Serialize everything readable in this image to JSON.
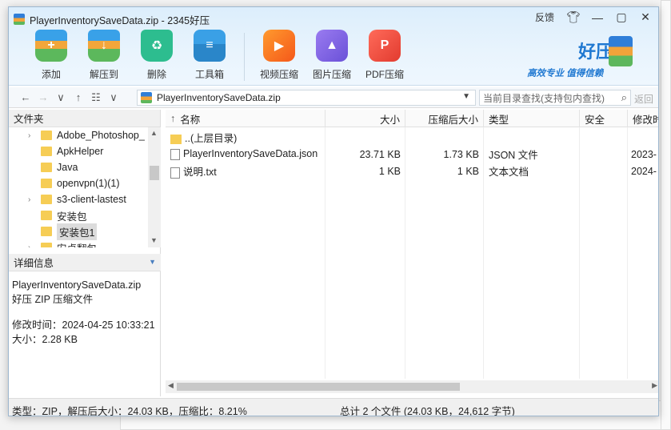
{
  "window": {
    "title": "PlayerInventorySaveData.zip - 2345好压",
    "feedback": "反馈",
    "skin_icon": "shirt-icon",
    "minimize_icon": "minimize-icon",
    "maximize_icon": "maximize-icon",
    "close_icon": "close-icon"
  },
  "toolbar": [
    {
      "label": "添加",
      "icon": "add-archive-icon"
    },
    {
      "label": "解压到",
      "icon": "extract-icon"
    },
    {
      "label": "删除",
      "icon": "recycle-icon"
    },
    {
      "label": "工具箱",
      "icon": "toolbox-icon"
    },
    {
      "label": "视频压缩",
      "icon": "video-compress-icon"
    },
    {
      "label": "图片压缩",
      "icon": "image-compress-icon"
    },
    {
      "label": "PDF压缩",
      "icon": "pdf-compress-icon"
    }
  ],
  "brand": {
    "name": "好压",
    "slogan": "高效专业  值得信赖",
    "color": "#1f78d1"
  },
  "address": {
    "path": "PlayerInventorySaveData.zip",
    "search_placeholder": "当前目录查找(支持包内查找)",
    "back_label": "返回"
  },
  "left_panel": {
    "folder_header": "文件夹",
    "tree": [
      {
        "label": "Adobe_Photoshop_",
        "expandable": true
      },
      {
        "label": "ApkHelper",
        "expandable": false
      },
      {
        "label": "Java",
        "expandable": false
      },
      {
        "label": "openvpn(1)(1)",
        "expandable": false
      },
      {
        "label": "s3-client-lastest",
        "expandable": true
      },
      {
        "label": "安装包",
        "expandable": false
      },
      {
        "label": "安装包1",
        "expandable": false,
        "selected": true
      },
      {
        "label": "安卓翻包",
        "expandable": true
      }
    ],
    "detail_header": "详细信息",
    "detail": {
      "name": "PlayerInventorySaveData.zip",
      "type": "好压 ZIP 压缩文件",
      "modified": "修改时间：2024-04-25 10:33:21",
      "size": "大小：2.28 KB"
    }
  },
  "file_list": {
    "columns": [
      "名称",
      "大小",
      "压缩后大小",
      "类型",
      "安全",
      "修改时"
    ],
    "rows": [
      {
        "name": "..(上层目录)",
        "size": "",
        "packed": "",
        "type": "",
        "security": "",
        "modified": "",
        "kind": "folder"
      },
      {
        "name": "PlayerInventorySaveData.json",
        "size": "23.71 KB",
        "packed": "1.73 KB",
        "type": "JSON 文件",
        "security": "",
        "modified": "2023-",
        "kind": "file"
      },
      {
        "name": "说明.txt",
        "size": "1 KB",
        "packed": "1 KB",
        "type": "文本文档",
        "security": "",
        "modified": "2024-",
        "kind": "file"
      }
    ]
  },
  "status": {
    "left": "类型：ZIP，解压后大小：24.03 KB，压缩比：8.21%",
    "right": "总计 2 个文件 (24.03 KB，24,612 字节)"
  }
}
